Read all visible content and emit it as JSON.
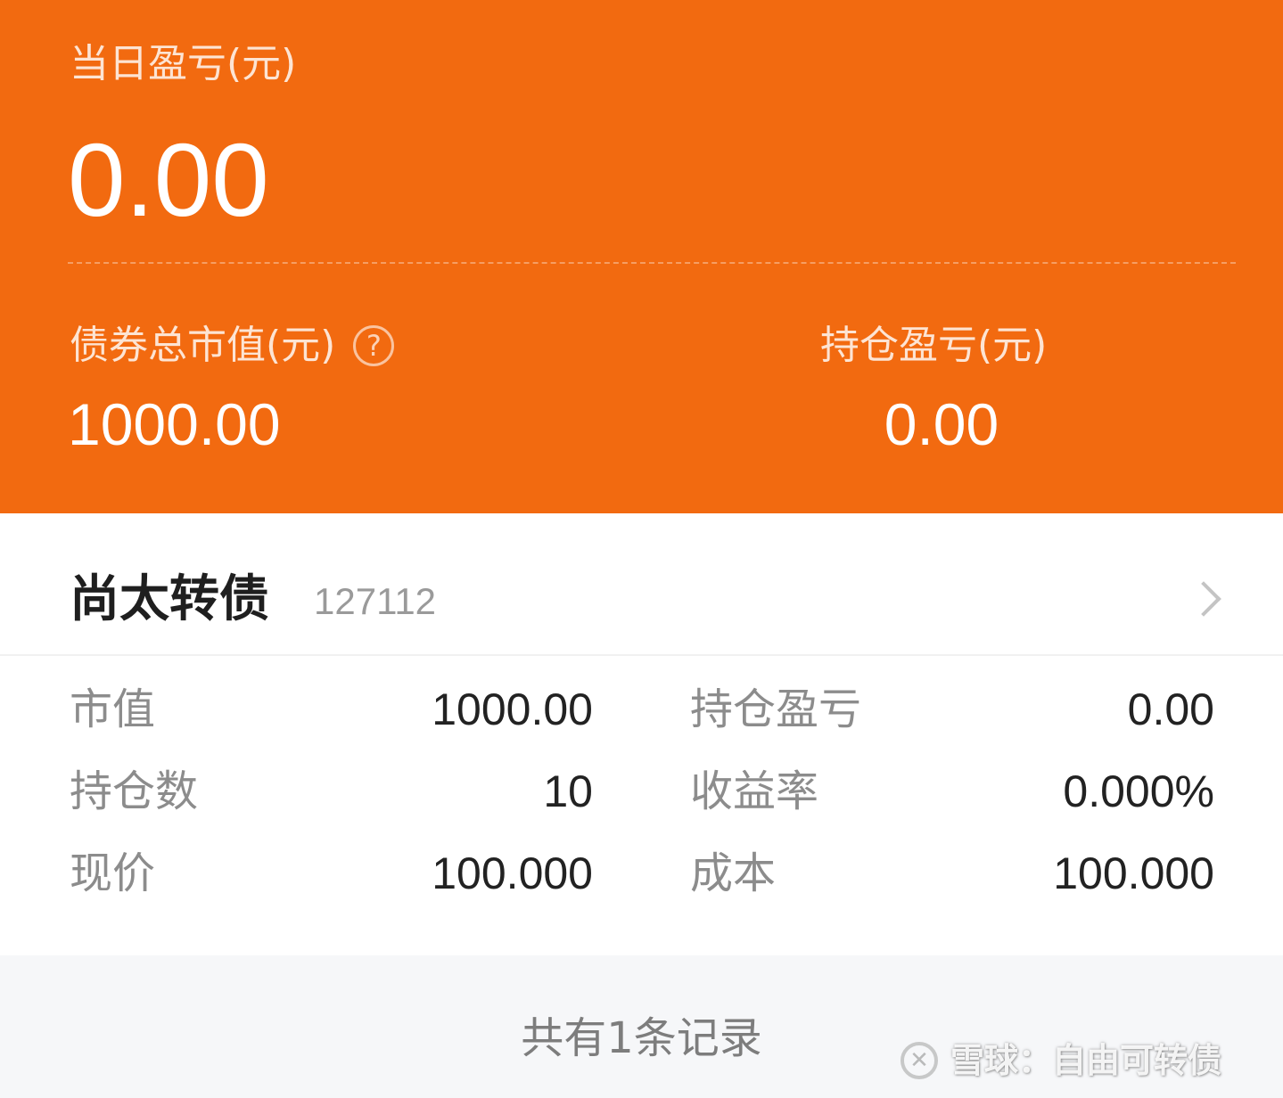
{
  "summary": {
    "daily_pnl_label": "当日盈亏(元)",
    "daily_pnl_value": "0.00",
    "market_value_label": "债券总市值(元)",
    "market_value_value": "1000.00",
    "holding_pnl_label": "持仓盈亏(元)",
    "holding_pnl_value": "0.00",
    "help_glyph": "?"
  },
  "holding": {
    "name": "尚太转债",
    "code": "127112",
    "stats": [
      {
        "left_label": "市值",
        "left_value": "1000.00",
        "right_label": "持仓盈亏",
        "right_value": "0.00"
      },
      {
        "left_label": "持仓数",
        "left_value": "10",
        "right_label": "收益率",
        "right_value": "0.000%"
      },
      {
        "left_label": "现价",
        "left_value": "100.000",
        "right_label": "成本",
        "right_value": "100.000"
      }
    ]
  },
  "footer": {
    "record_count": "共有1条记录",
    "watermark_text": "雪球：自由可转债"
  },
  "colors": {
    "header_bg": "#f26a10",
    "card_bg": "#ffffff",
    "page_bg": "#f6f7f9"
  },
  "icons": {
    "help": "question-circle-icon",
    "chevron": "chevron-right-icon",
    "watermark_logo": "xueqiu-logo-icon"
  }
}
